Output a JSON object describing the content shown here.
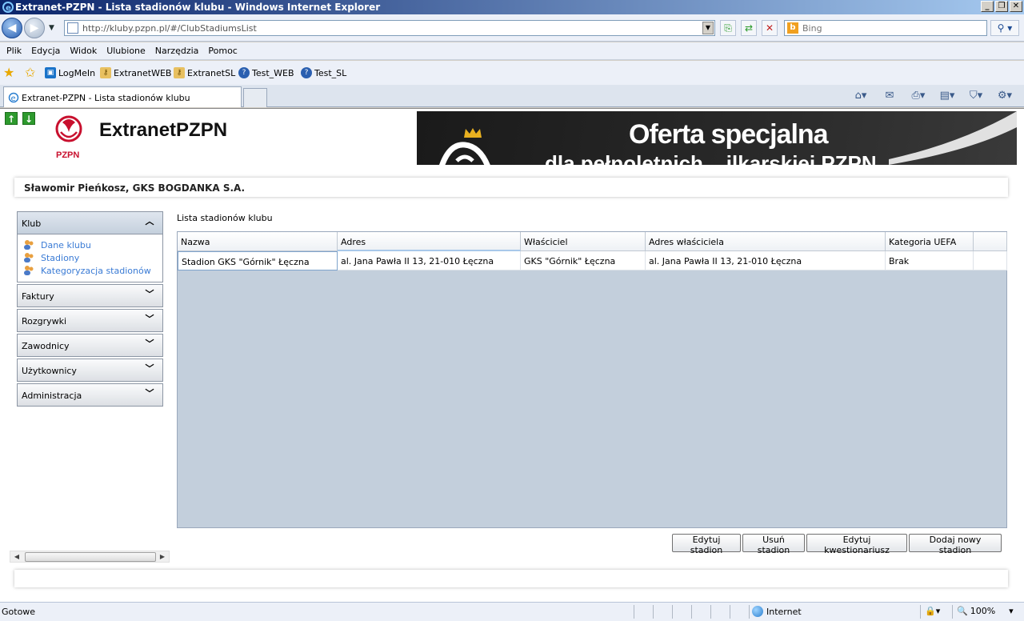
{
  "window": {
    "title": "Extranet-PZPN - Lista stadionów klubu - Windows Internet Explorer"
  },
  "address_bar": {
    "url": "http://kluby.pzpn.pl/#/ClubStadiumsList",
    "search_placeholder": "Bing"
  },
  "menu": [
    "Plik",
    "Edycja",
    "Widok",
    "Ulubione",
    "Narzędzia",
    "Pomoc"
  ],
  "favorites": [
    {
      "label": "LogMeIn",
      "icon": "logmein-icon",
      "color": "#1a73c9"
    },
    {
      "label": "ExtranetWEB",
      "icon": "key-icon",
      "color": "#d8a030"
    },
    {
      "label": "ExtranetSL",
      "icon": "key-icon",
      "color": "#d8a030"
    },
    {
      "label": "Test_WEB",
      "icon": "help-icon",
      "color": "#2a5fb0"
    },
    {
      "label": "Test_SL",
      "icon": "help-icon",
      "color": "#2a5fb0"
    }
  ],
  "tab": {
    "title": "Extranet-PZPN - Lista stadionów klubu"
  },
  "header": {
    "logo_text": "ExtranetPZPN",
    "logo_caption": "PZPN",
    "banner_line1": "Oferta specjalna",
    "banner_line2": "dla pełnoletnich ...ilkarskiej PZPN"
  },
  "user": {
    "name": "Sławomir Pieńkosz, GKS BOGDANKA S.A."
  },
  "sidebar": {
    "sections": [
      {
        "label": "Klub",
        "open": true,
        "items": [
          "Dane klubu",
          "Stadiony",
          "Kategoryzacja stadionów"
        ]
      },
      {
        "label": "Faktury",
        "open": false
      },
      {
        "label": "Rozgrywki",
        "open": false
      },
      {
        "label": "Zawodnicy",
        "open": false
      },
      {
        "label": "Użytkownicy",
        "open": false
      },
      {
        "label": "Administracja",
        "open": false
      }
    ]
  },
  "main": {
    "title": "Lista stadionów klubu",
    "columns": [
      "Nazwa",
      "Adres",
      "Właściciel",
      "Adres właściciela",
      "Kategoria UEFA"
    ],
    "rows": [
      [
        "Stadion GKS \"Górnik\" Łęczna",
        "al. Jana Pawła II 13, 21-010 Łęczna",
        "GKS \"Górnik\" Łęczna",
        "al. Jana Pawła II 13, 21-010 Łęczna",
        "Brak"
      ]
    ],
    "buttons": {
      "edit": "Edytuj stadion",
      "delete": "Usuń stadion",
      "questionnaire": "Edytuj kwestionariusz",
      "add": "Dodaj nowy stadion"
    }
  },
  "status": {
    "text": "Gotowe",
    "zone": "Internet",
    "zoom": "100%"
  }
}
